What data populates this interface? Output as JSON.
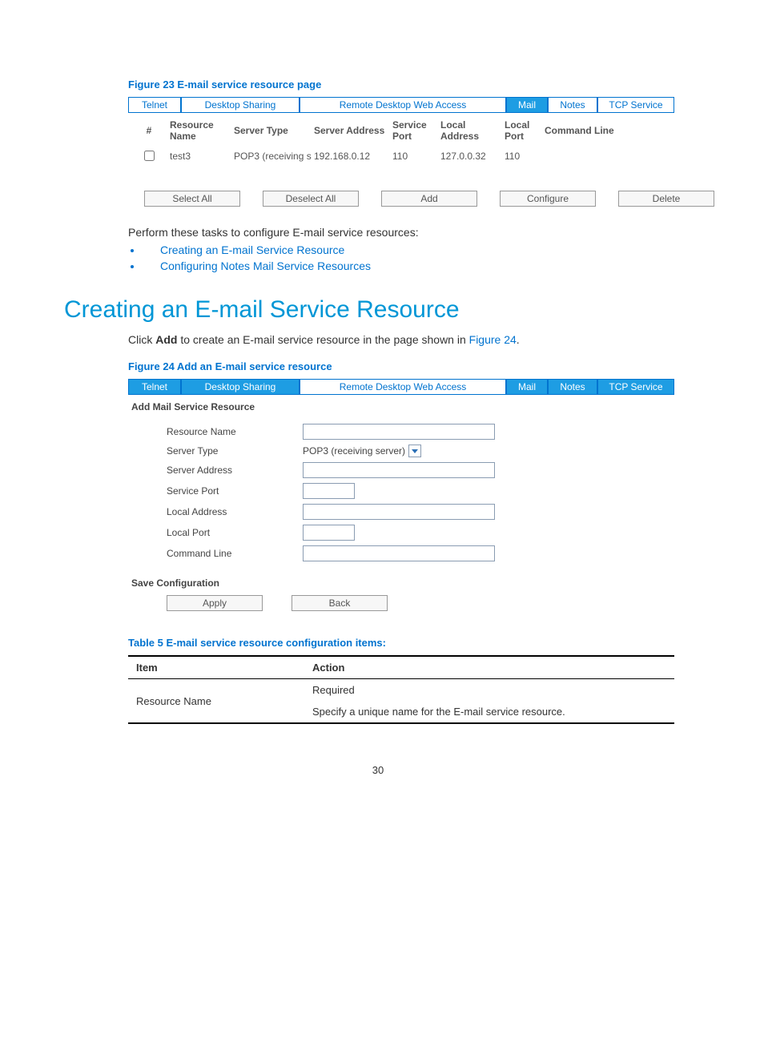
{
  "figure23_caption": "Figure 23 E-mail service resource page",
  "fig23": {
    "tabs": {
      "telnet": "Telnet",
      "desktop_sharing": "Desktop Sharing",
      "rdwa": "Remote Desktop Web Access",
      "mail": "Mail",
      "notes": "Notes",
      "tcp": "TCP Service"
    },
    "headers": {
      "num": "#",
      "name": "Resource Name",
      "type": "Server Type",
      "addr": "Server Address",
      "sport": "Service Port",
      "laddr": "Local Address",
      "lport": "Local Port",
      "cmd": "Command Line"
    },
    "row": {
      "name": "test3",
      "type": "POP3 (receiving s",
      "addr": "192.168.0.12",
      "sport": "110",
      "laddr": "127.0.0.32",
      "lport": "110",
      "cmd": ""
    },
    "buttons": {
      "select_all": "Select All",
      "deselect_all": "Deselect All",
      "add": "Add",
      "configure": "Configure",
      "delete": "Delete"
    }
  },
  "intro_text": "Perform these tasks to configure E-mail service resources:",
  "links": {
    "create": "Creating an E-mail Service Resource",
    "notes": "Configuring Notes Mail Service Resources"
  },
  "section_heading": "Creating an E-mail Service Resource",
  "click_add_pre": "Click ",
  "click_add_bold": "Add",
  "click_add_post": " to create an E-mail service resource in the page shown in ",
  "figure24_link": "Figure 24",
  "figure24_period": ".",
  "figure24_caption": "Figure 24 Add an E-mail service resource",
  "fig24": {
    "title": "Add Mail Service Resource",
    "labels": {
      "name": "Resource Name",
      "type": "Server Type",
      "type_value": "POP3 (receiving server)",
      "addr": "Server Address",
      "sport": "Service Port",
      "laddr": "Local Address",
      "lport": "Local Port",
      "cmd": "Command Line"
    },
    "savecfg": "Save Configuration",
    "apply": "Apply",
    "back": "Back"
  },
  "table5_caption": "Table 5 E-mail service resource configuration items:",
  "table5": {
    "h_item": "Item",
    "h_action": "Action",
    "r1_item": "Resource Name",
    "r1_a1": "Required",
    "r1_a2": "Specify a unique name for the E-mail service resource."
  },
  "page_number": "30"
}
